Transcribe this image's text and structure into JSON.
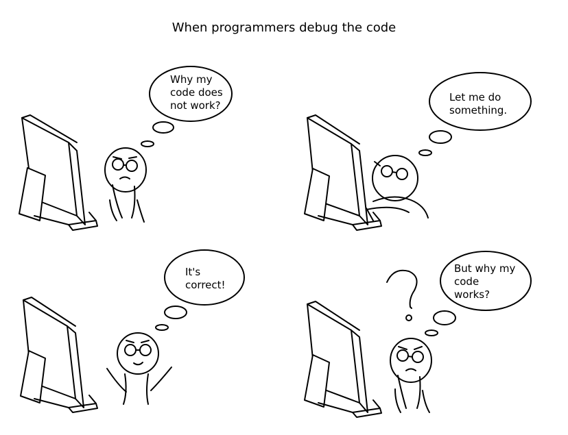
{
  "comic": {
    "title": "When programmers debug the code",
    "panels": [
      {
        "bubble_lines": [
          "Why my",
          "code does",
          "not work?"
        ]
      },
      {
        "bubble_lines": [
          "Let me do",
          "something."
        ]
      },
      {
        "bubble_lines": [
          "It's",
          "correct!"
        ]
      },
      {
        "bubble_lines": [
          "But why my",
          "code",
          "works?"
        ]
      }
    ]
  }
}
